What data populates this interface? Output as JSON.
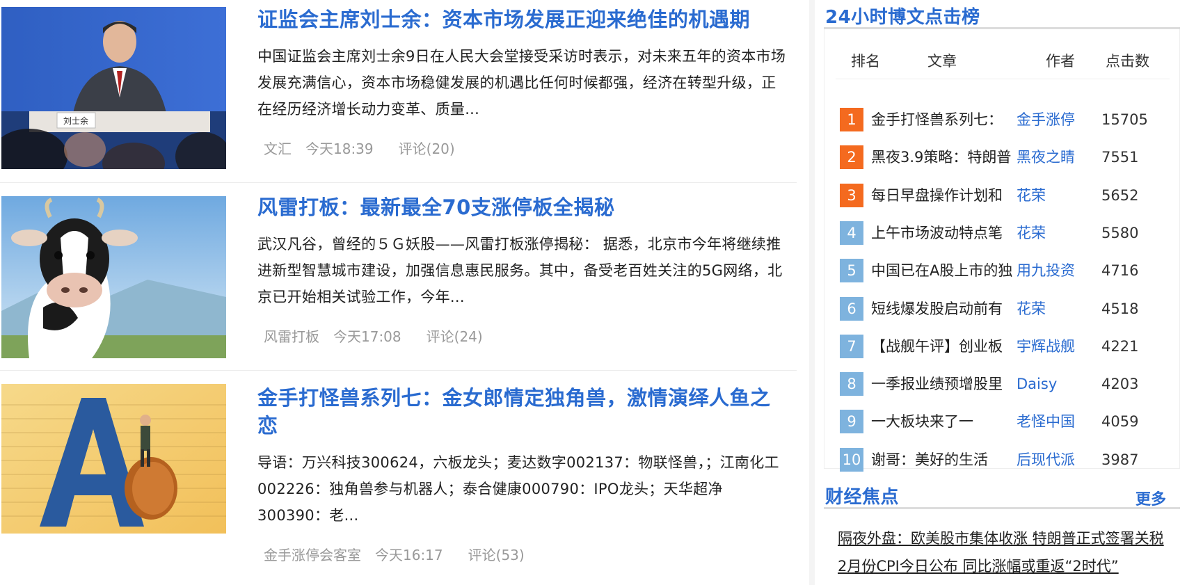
{
  "articles": [
    {
      "title": "证监会主席刘士余：资本市场发展正迎来绝佳的机遇期",
      "summary": "中国证监会主席刘士余9日在人民大会堂接受采访时表示，对未来五年的资本市场发展充满信心，资本市场稳健发展的机遇比任何时候都强，经济在转型升级，正在经历经济增长动力变革、质量...",
      "author": "文汇",
      "time": "今天18:39",
      "comments": "评论(20)",
      "image_label": "刘士余"
    },
    {
      "title": "风雷打板：最新最全70支涨停板全揭秘",
      "summary": "武汉凡谷，曾经的５Ｇ妖股——风雷打板涨停揭秘： 据悉，北京市今年将继续推进新型智慧城市建设，加强信息惠民服务。其中，备受老百姓关注的5G网络，北京已开始相关试验工作，今年...",
      "author": "风雷打板",
      "time": "今天17:08",
      "comments": "评论(24)"
    },
    {
      "title": "金手打怪兽系列七：金女郎情定独角兽，激情演绎人鱼之恋",
      "summary": "导语：万兴科技300624，六板龙头；麦达数字002137：物联怪兽，；江南化工002226：独角兽参与机器人；泰合健康000790：IPO龙头；天华超净300390：老...",
      "author": "金手涨停会客室",
      "time": "今天16:17",
      "comments": "评论(53)"
    }
  ],
  "ranking": {
    "title": "24小时博文点击榜",
    "headers": {
      "rank": "排名",
      "article": "文章",
      "author": "作者",
      "clicks": "点击数"
    },
    "rows": [
      {
        "rank": "1",
        "title": "金手打怪兽系列七：",
        "author": "金手涨停",
        "clicks": "15705"
      },
      {
        "rank": "2",
        "title": "黑夜3.9策略：特朗普",
        "author": "黑夜之睛",
        "clicks": "7551"
      },
      {
        "rank": "3",
        "title": "每日早盘操作计划和",
        "author": "花荣",
        "clicks": "5652"
      },
      {
        "rank": "4",
        "title": "上午市场波动特点笔",
        "author": "花荣",
        "clicks": "5580"
      },
      {
        "rank": "5",
        "title": "中国已在A股上市的独",
        "author": "用九投资",
        "clicks": "4716"
      },
      {
        "rank": "6",
        "title": "短线爆发股启动前有",
        "author": "花荣",
        "clicks": "4518"
      },
      {
        "rank": "7",
        "title": "【战舰午评】创业板",
        "author": "宇辉战舰",
        "clicks": "4221"
      },
      {
        "rank": "8",
        "title": "一季报业绩预增股里",
        "author": "Daisy",
        "clicks": "4203"
      },
      {
        "rank": "9",
        "title": "一大板块来了一",
        "author": "老怪中国",
        "clicks": "4059"
      },
      {
        "rank": "10",
        "title": "谢哥：美好的生活",
        "author": "后现代派",
        "clicks": "3987"
      }
    ]
  },
  "focus": {
    "title": "财经焦点",
    "more": "更多",
    "items": [
      "隔夜外盘：欧美股市集体收涨 特朗普正式签署关税",
      "2月份CPI今日公布 同比涨幅或重返“2时代”"
    ]
  },
  "colors": {
    "link": "#2a6bd0",
    "hot_rank": "#f46a1f",
    "cold_rank": "#7eb3de",
    "meta": "#999999"
  }
}
